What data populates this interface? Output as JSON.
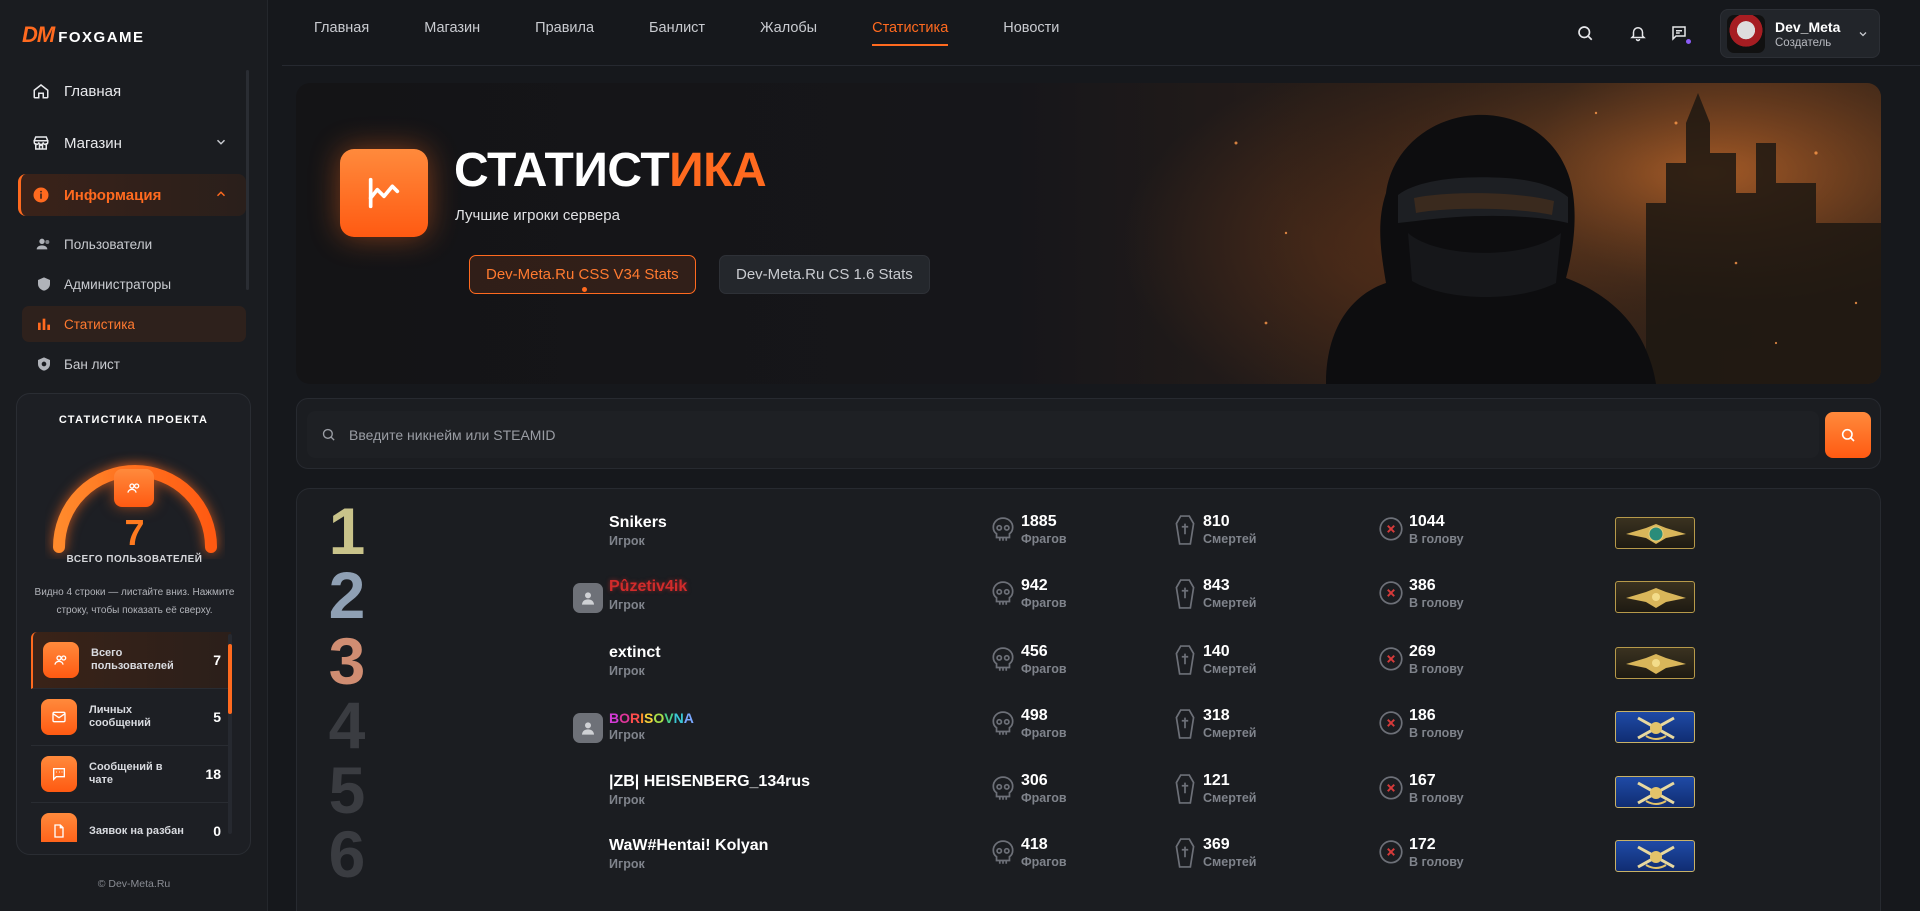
{
  "app": {
    "logo_dm": "DM",
    "logo_text": "FOXGAME",
    "copyright": "© Dev-Meta.Ru"
  },
  "sidebar": {
    "items": [
      {
        "label": "Главная"
      },
      {
        "label": "Магазин"
      },
      {
        "label": "Информация"
      }
    ],
    "sub_items": [
      {
        "label": "Пользователи"
      },
      {
        "label": "Администраторы"
      },
      {
        "label": "Статистика"
      },
      {
        "label": "Бан лист"
      }
    ]
  },
  "project_stats": {
    "title": "СТАТИСТИКА ПРОЕКТА",
    "total_value": "7",
    "total_label": "ВСЕГО ПОЛЬЗОВАТЕЛЕЙ",
    "hint": "Видно 4 строки — листайте вниз. Нажмите строку, чтобы показать её сверху.",
    "rows": [
      {
        "label": "Всего пользователей",
        "value": "7"
      },
      {
        "label": "Личных сообщений",
        "value": "5"
      },
      {
        "label": "Сообщений в чате",
        "value": "18"
      },
      {
        "label": "Заявок на разбан",
        "value": "0"
      }
    ]
  },
  "topnav": {
    "items": [
      {
        "label": "Главная"
      },
      {
        "label": "Магазин"
      },
      {
        "label": "Правила"
      },
      {
        "label": "Банлист"
      },
      {
        "label": "Жалобы"
      },
      {
        "label": "Статистика"
      },
      {
        "label": "Новости"
      }
    ],
    "active_index": 5
  },
  "user": {
    "name": "Dev_Meta",
    "role": "Создатель"
  },
  "hero": {
    "title_main": "СТАТИСТ",
    "title_accent": "ИКА",
    "subtitle": "Лучшие игроки сервера",
    "servers": [
      {
        "label": "Dev-Meta.Ru CSS V34 Stats",
        "active": true
      },
      {
        "label": "Dev-Meta.Ru CS 1.6 Stats",
        "active": false
      }
    ]
  },
  "search": {
    "placeholder": "Введите никнейм или STEAMID"
  },
  "stat_labels": {
    "frags": "Фрагов",
    "deaths": "Смертей",
    "headshots": "В голову"
  },
  "players": [
    {
      "rank": "1",
      "name": "Snikers",
      "role": "Игрок",
      "frags": "1885",
      "deaths": "810",
      "headshots": "1044",
      "has_avatar": false,
      "badge": "gold-eagle-globe"
    },
    {
      "rank": "2",
      "name": "Pûzetiv4ik",
      "role": "Игрок",
      "frags": "942",
      "deaths": "843",
      "headshots": "386",
      "has_avatar": true,
      "badge": "gold-eagle"
    },
    {
      "rank": "3",
      "name": "extinct",
      "role": "Игрок",
      "frags": "456",
      "deaths": "140",
      "headshots": "269",
      "has_avatar": false,
      "badge": "gold-eagle-small"
    },
    {
      "rank": "4",
      "name": "BORISOVNA",
      "role": "Игрок",
      "frags": "498",
      "deaths": "318",
      "headshots": "186",
      "has_avatar": true,
      "badge": "blue-crossed-rifles"
    },
    {
      "rank": "5",
      "name": "|ZB| HEISENBERG_134rus",
      "role": "Игрок",
      "frags": "306",
      "deaths": "121",
      "headshots": "167",
      "has_avatar": false,
      "badge": "blue-crossed-rifles"
    },
    {
      "rank": "6",
      "name": "WaW#Hentai! Kolyan",
      "role": "Игрок",
      "frags": "418",
      "deaths": "369",
      "headshots": "172",
      "has_avatar": false,
      "badge": "blue-crossed-rifles"
    }
  ],
  "colors": {
    "accent": "#ff6a1f",
    "rank_1": "#c9c38a",
    "rank_2": "#8fa0b4",
    "rank_3": "#d08d72",
    "rank_other": "#3a3c41",
    "name_2": "#d12b2b"
  }
}
